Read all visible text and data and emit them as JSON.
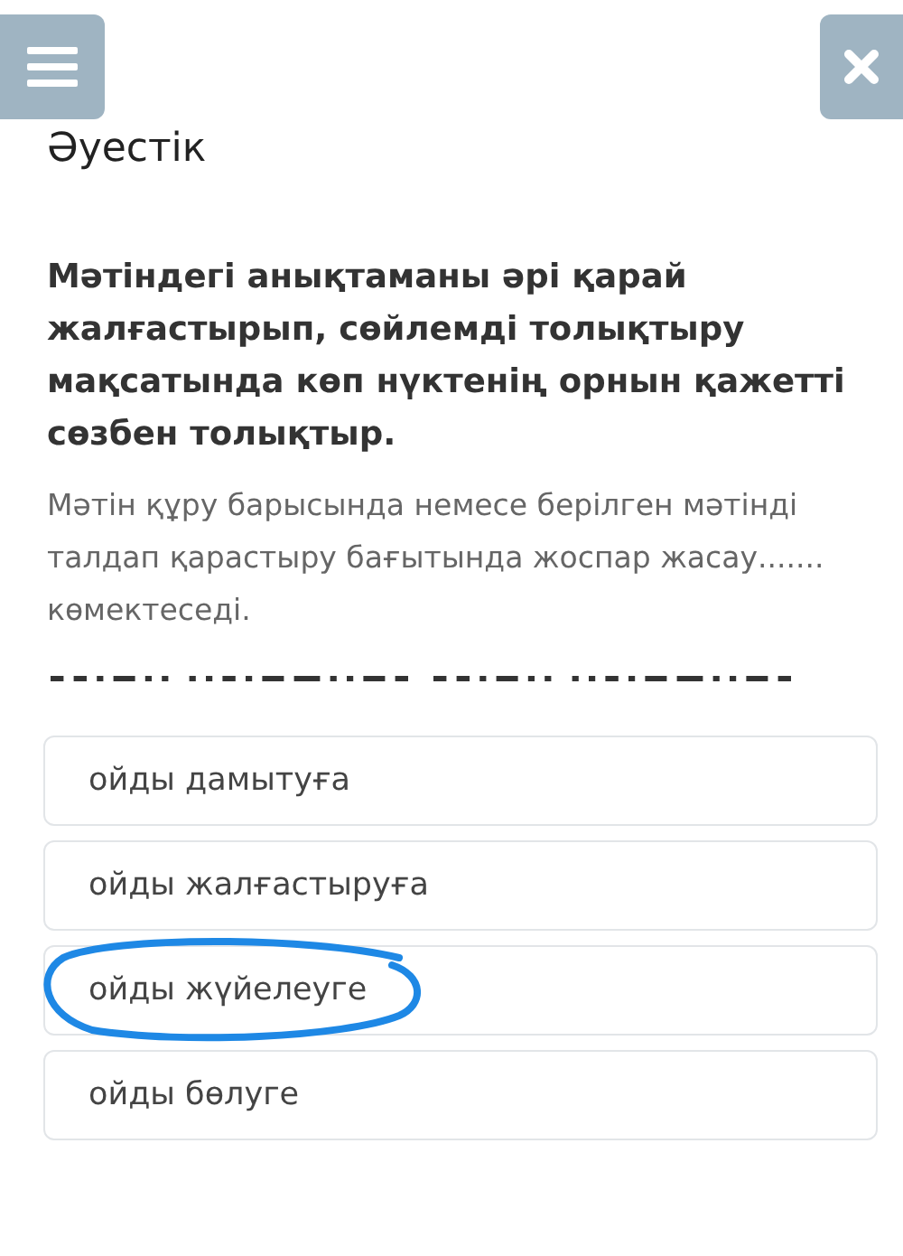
{
  "title": "Әуестік",
  "question": "Мәтіндегі анықтаманы әрі қарай жалғастырып, сөйлемді толықтыру мақсатында көп нүктенің орнын қажетті сөзбен толықтыр.",
  "text": "Мәтін құру барысында немесе берілген мәтінді талдап қарастыру бағытында жоспар жасау....... көмектеседі.",
  "options": [
    {
      "label": "ойды дамытуға",
      "selected": false
    },
    {
      "label": "ойды жалғастыруға",
      "selected": false
    },
    {
      "label": "ойды жүйелеуге",
      "selected": true
    },
    {
      "label": "ойды бөлуге",
      "selected": false
    }
  ]
}
